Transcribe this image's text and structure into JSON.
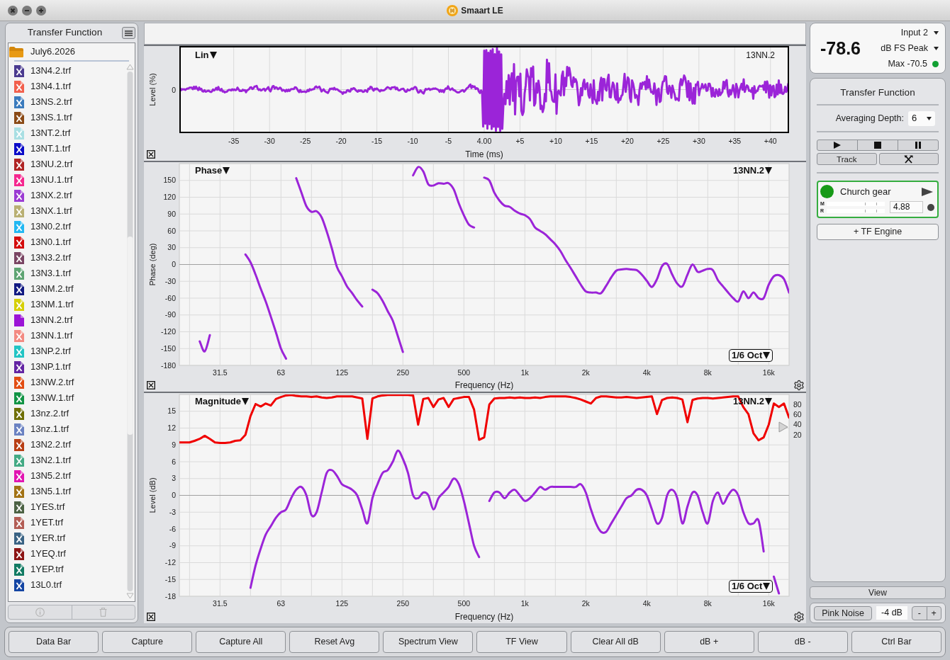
{
  "window": {
    "title": "Smaart LE"
  },
  "file_browser": {
    "title": "Transfer Function",
    "folder": "July6.2026",
    "files": [
      {
        "name": "13N4.2.trf",
        "color": "#4b3b8f",
        "plotted": false
      },
      {
        "name": "13N4.1.trf",
        "color": "#f2604d",
        "plotted": false
      },
      {
        "name": "13NS.2.trf",
        "color": "#3b7bbd",
        "plotted": false
      },
      {
        "name": "13NS.1.trf",
        "color": "#8a4a16",
        "plotted": false
      },
      {
        "name": "13NT.2.trf",
        "color": "#a9dfe3",
        "plotted": false
      },
      {
        "name": "13NT.1.trf",
        "color": "#0b0bc8",
        "plotted": false
      },
      {
        "name": "13NU.2.trf",
        "color": "#b02424",
        "plotted": false
      },
      {
        "name": "13NU.1.trf",
        "color": "#f5288f",
        "plotted": false
      },
      {
        "name": "13NX.2.trf",
        "color": "#9b3bd3",
        "plotted": false
      },
      {
        "name": "13NX.1.trf",
        "color": "#b9b073",
        "plotted": false
      },
      {
        "name": "13N0.2.trf",
        "color": "#22b8f2",
        "plotted": false
      },
      {
        "name": "13N0.1.trf",
        "color": "#d40c0c",
        "plotted": false
      },
      {
        "name": "13N3.2.trf",
        "color": "#7a4563",
        "plotted": false
      },
      {
        "name": "13N3.1.trf",
        "color": "#5ea472",
        "plotted": false
      },
      {
        "name": "13NM.2.trf",
        "color": "#121a82",
        "plotted": false
      },
      {
        "name": "13NM.1.trf",
        "color": "#d6cf05",
        "plotted": false
      },
      {
        "name": "13NN.2.trf",
        "color": "#9b14d6",
        "plotted": true
      },
      {
        "name": "13NN.1.trf",
        "color": "#f38a82",
        "plotted": false
      },
      {
        "name": "13NP.2.trf",
        "color": "#22c4c4",
        "plotted": false
      },
      {
        "name": "13NP.1.trf",
        "color": "#6324a3",
        "plotted": false
      },
      {
        "name": "13NW.2.trf",
        "color": "#e24d12",
        "plotted": false
      },
      {
        "name": "13NW.1.trf",
        "color": "#129445",
        "plotted": false
      },
      {
        "name": "13nz.2.trf",
        "color": "#6e6e05",
        "plotted": false
      },
      {
        "name": "13nz.1.trf",
        "color": "#6b82c2",
        "plotted": false
      },
      {
        "name": "13N2.2.trf",
        "color": "#b83e14",
        "plotted": false
      },
      {
        "name": "13N2.1.trf",
        "color": "#43aa84",
        "plotted": false
      },
      {
        "name": "13N5.2.trf",
        "color": "#e214b2",
        "plotted": false
      },
      {
        "name": "13N5.1.trf",
        "color": "#a27214",
        "plotted": false
      },
      {
        "name": "1YES.trf",
        "color": "#4c6244",
        "plotted": false
      },
      {
        "name": "1YET.trf",
        "color": "#b35d55",
        "plotted": false
      },
      {
        "name": "1YER.trf",
        "color": "#3a6384",
        "plotted": false
      },
      {
        "name": "1YEQ.trf",
        "color": "#8c1414",
        "plotted": false
      },
      {
        "name": "1YEP.trf",
        "color": "#127b63",
        "plotted": false
      },
      {
        "name": "13L0.trf",
        "color": "#1445a3",
        "plotted": false
      }
    ],
    "actions": [
      {
        "kind": "info",
        "disabled": true
      },
      {
        "kind": "delete",
        "disabled": true
      }
    ]
  },
  "time_plot": {
    "mode": "Lin",
    "trace": "13NN.2",
    "ylabel": "Level (%)",
    "yticks": [
      "0"
    ],
    "xticks": [
      "-35",
      "-30",
      "-25",
      "-20",
      "-15",
      "-10",
      "-5",
      "4.00",
      "+5",
      "+10",
      "+15",
      "+20",
      "+25",
      "+30",
      "+35",
      "+40"
    ],
    "xlabel": "Time (ms)"
  },
  "phase_plot": {
    "mode": "Phase",
    "smoothing": "1/6 Oct",
    "chart_data": {
      "type": "line",
      "xlabel": "Frequency (Hz)",
      "ylabel": "Phase (deg)",
      "grid": true,
      "ylim": [
        -180,
        180
      ],
      "yticks": [
        150,
        120,
        90,
        60,
        30,
        0,
        -30,
        -60,
        -90,
        -120,
        -150,
        -180
      ],
      "categories": [
        null,
        null,
        null,
        null,
        null,
        null,
        null,
        null,
        "31.5",
        null,
        null,
        null,
        null,
        null,
        null,
        null,
        null,
        null,
        null,
        null,
        "63",
        null,
        null,
        null,
        null,
        null,
        null,
        null,
        null,
        null,
        null,
        null,
        "125",
        null,
        null,
        null,
        null,
        null,
        null,
        null,
        null,
        null,
        null,
        null,
        "250",
        null,
        null,
        null,
        null,
        null,
        null,
        null,
        null,
        null,
        null,
        null,
        "500",
        null,
        null,
        null,
        null,
        null,
        null,
        null,
        null,
        null,
        null,
        null,
        "1k",
        null,
        null,
        null,
        null,
        null,
        null,
        null,
        null,
        null,
        null,
        null,
        "2k",
        null,
        null,
        null,
        null,
        null,
        null,
        null,
        null,
        null,
        null,
        null,
        "4k",
        null,
        null,
        null,
        null,
        null,
        null,
        null,
        null,
        null,
        null,
        null,
        "8k",
        null,
        null,
        null,
        null,
        null,
        null,
        null,
        null,
        null,
        null,
        null,
        "16k",
        null,
        null,
        null,
        null
      ],
      "series": [
        {
          "name": "13NN.2",
          "color": "#9b24d8",
          "values": [
            null,
            null,
            null,
            null,
            -137,
            -155,
            -126,
            null,
            null,
            null,
            null,
            null,
            null,
            18,
            4,
            -18,
            -43,
            -66,
            -93,
            -121,
            -150,
            -168,
            null,
            154,
            129,
            104,
            94,
            95,
            84,
            59,
            29,
            -4,
            -21,
            -39,
            -51,
            -64,
            -75,
            null,
            -45,
            -51,
            -65,
            -83,
            -100,
            -128,
            -156,
            null,
            159,
            174,
            166,
            143,
            141,
            145,
            144,
            145,
            134,
            109,
            88,
            71,
            66,
            null,
            155,
            150,
            128,
            114,
            105,
            103,
            96,
            91,
            88,
            81,
            66,
            60,
            54,
            45,
            36,
            24,
            8,
            -6,
            -21,
            -36,
            -48,
            -50,
            -50,
            -51,
            -38,
            -23,
            -11,
            -9,
            -8,
            -9,
            -10,
            -18,
            -29,
            -40,
            -26,
            -3,
            1,
            -18,
            -34,
            -39,
            -18,
            0,
            -13,
            -11,
            -8,
            -10,
            -28,
            -39,
            -50,
            -60,
            -66,
            -48,
            -60,
            -50,
            -60,
            -60,
            -36,
            -21,
            -19,
            -26,
            -50
          ]
        }
      ]
    }
  },
  "magnitude_plot": {
    "mode": "Magnitude",
    "smoothing": "1/6 Oct",
    "chart_data": {
      "type": "line",
      "xlabel": "Frequency (Hz)",
      "ylabel": "Level (dB)",
      "grid": true,
      "ylim": [
        -18,
        18
      ],
      "y2lim": [
        -300,
        100
      ],
      "yticks": [
        15,
        12,
        9,
        6,
        3,
        0,
        -3,
        -6,
        -9,
        -12,
        -15,
        -18
      ],
      "y2ticks": [
        80,
        60,
        40,
        20
      ],
      "categories": [
        null,
        null,
        null,
        null,
        null,
        null,
        null,
        null,
        "31.5",
        null,
        null,
        null,
        null,
        null,
        null,
        null,
        null,
        null,
        null,
        null,
        "63",
        null,
        null,
        null,
        null,
        null,
        null,
        null,
        null,
        null,
        null,
        null,
        "125",
        null,
        null,
        null,
        null,
        null,
        null,
        null,
        null,
        null,
        null,
        null,
        "250",
        null,
        null,
        null,
        null,
        null,
        null,
        null,
        null,
        null,
        null,
        null,
        "500",
        null,
        null,
        null,
        null,
        null,
        null,
        null,
        null,
        null,
        null,
        null,
        "1k",
        null,
        null,
        null,
        null,
        null,
        null,
        null,
        null,
        null,
        null,
        null,
        "2k",
        null,
        null,
        null,
        null,
        null,
        null,
        null,
        null,
        null,
        null,
        null,
        "4k",
        null,
        null,
        null,
        null,
        null,
        null,
        null,
        null,
        null,
        null,
        null,
        "8k",
        null,
        null,
        null,
        null,
        null,
        null,
        null,
        null,
        null,
        null,
        null,
        "16k",
        null,
        null,
        null,
        null
      ],
      "series": [
        {
          "name": "13NN.2",
          "color": "#9b24d8",
          "values": [
            null,
            null,
            null,
            null,
            null,
            null,
            null,
            null,
            null,
            null,
            null,
            null,
            null,
            null,
            -16.5,
            -12.5,
            -9.5,
            -7,
            -5.5,
            -4,
            -3,
            -2.5,
            -0.5,
            1,
            1.5,
            0,
            -3.5,
            -3,
            0.5,
            4,
            4.5,
            3.5,
            2,
            1.5,
            1,
            0,
            -2.5,
            -5,
            -0.5,
            2,
            4,
            4.5,
            6,
            8,
            6.5,
            4,
            0,
            -0.5,
            0.5,
            0,
            -2.5,
            -0.5,
            0.5,
            1.5,
            3,
            2,
            -1,
            -5,
            -9,
            -11,
            null,
            -1,
            0.5,
            0.5,
            -0.5,
            0.5,
            1,
            0,
            -1,
            -0.5,
            0.5,
            1.5,
            1,
            1.5,
            1.5,
            1.5,
            1.5,
            1.5,
            1.5,
            2,
            0.5,
            -2.5,
            -5,
            -6.5,
            -6.5,
            -5,
            -3.5,
            -2,
            -0.5,
            0,
            1,
            1,
            0,
            -2.5,
            -5,
            -4,
            0,
            1,
            -0.5,
            -5,
            -2,
            0.5,
            0,
            -3,
            -5,
            -1,
            0.5,
            -1.5,
            0,
            1,
            0,
            -3,
            -5,
            -5,
            -4.5,
            -10,
            null,
            -14.5,
            -17.5,
            null,
            null
          ]
        },
        {
          "color": "#f00000",
          "axis": "y2",
          "values": [
            5,
            5,
            5,
            8,
            12,
            18,
            12,
            5,
            4,
            4,
            5,
            8,
            9,
            20,
            57,
            81,
            76,
            82,
            78,
            91,
            95,
            98,
            99,
            97,
            96,
            96,
            95,
            96,
            94,
            93,
            94,
            96,
            96,
            96,
            96,
            94,
            92,
            12,
            92,
            96,
            98,
            99,
            99,
            99,
            99,
            99,
            98,
            40,
            91,
            93,
            75,
            90,
            93,
            75,
            91,
            93,
            95,
            95,
            70,
            10,
            15,
            80,
            92,
            93,
            93,
            94,
            93,
            94,
            93,
            93,
            94,
            93,
            95,
            96,
            96,
            96,
            96,
            95,
            93,
            90,
            86,
            82,
            93,
            96,
            96,
            95,
            94,
            94,
            95,
            94,
            93,
            94,
            95,
            96,
            61,
            89,
            93,
            94,
            93,
            90,
            45,
            89,
            92,
            93,
            93,
            92,
            93,
            94,
            95,
            96,
            96,
            75,
            61,
            23,
            9,
            15,
            40,
            82,
            75,
            82,
            54
          ]
        }
      ]
    }
  },
  "level_meter": {
    "reading": "-78.6",
    "input": "Input 2",
    "units": "dB FS Peak",
    "max": "Max -70.5"
  },
  "control_panel": {
    "title": "Transfer Function",
    "averaging_label": "Averaging Depth:",
    "averaging_value": "6",
    "transport": [
      {
        "kind": "play"
      },
      {
        "kind": "stop"
      },
      {
        "kind": "pause"
      }
    ],
    "track_button": "Track",
    "engine": {
      "name": "Church gear",
      "on": true,
      "meters": [
        "M",
        "R"
      ],
      "delay": "4.88"
    },
    "add_engine": "+ TF Engine"
  },
  "view_button": "View",
  "generator": {
    "label": "Pink Noise",
    "gain": "-4 dB",
    "steppers": [
      "-",
      "+"
    ]
  },
  "bottom_bar": [
    "Data Bar",
    "Capture",
    "Capture All",
    "Reset Avg",
    "Spectrum View",
    "TF View",
    "Clear All dB",
    "dB +",
    "dB -",
    "Ctrl Bar"
  ]
}
